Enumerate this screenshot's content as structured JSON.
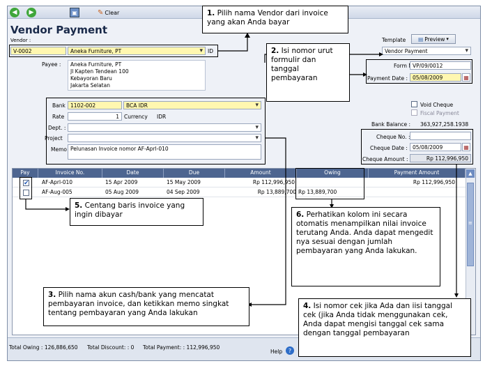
{
  "toolbar": {
    "clear_label": "Clear"
  },
  "header": {
    "title": "Vendor Payment",
    "vendor_label": "Vendor :",
    "template_label": "Template",
    "preview_label": "Preview"
  },
  "vendor": {
    "code": "V-0002",
    "name": "Aneka Furniture, PT",
    "id_suffix": "ID"
  },
  "template": {
    "value": "Vendor Payment"
  },
  "form": {
    "form_no_label": "Form No.",
    "form_no": "VP/09/0012",
    "payment_date_label": "Payment Date :",
    "payment_date": "05/08/2009"
  },
  "payee": {
    "label": "Payee :",
    "lines": [
      "Aneka Furniture, PT",
      "Jl Kapten Tendean 100",
      "Kebayoran Baru",
      "Jakarta Selatan"
    ]
  },
  "bank": {
    "bank_label": "Bank :",
    "bank_code": "1102-002",
    "bank_name": "BCA IDR",
    "rate_label": "Rate",
    "rate": "1",
    "currency_label": "Currency",
    "currency": "IDR",
    "dept_label": "Dept. :",
    "project_label": "Project",
    "memo_label": "Memo",
    "memo": "Pelunasan Invoice nomor AF-Aprl-010"
  },
  "cheque": {
    "void_label": "Void Cheque",
    "fiscal_label": "Fiscal Payment",
    "bank_balance_label": "Bank Balance :",
    "bank_balance": "363,927,258.1938",
    "cheque_no_label": "Cheque No. :",
    "cheque_date_label": "Cheque Date :",
    "cheque_date": "05/08/2009",
    "cheque_amount_label": "Cheque Amount :",
    "cheque_amount": "Rp 112,996,950"
  },
  "grid": {
    "headers": [
      "Pay",
      "Invoice No.",
      "Date",
      "Due",
      "Amount",
      "Owing",
      "Payment Amount"
    ],
    "rows": [
      {
        "invoice": "AF-Aprl-010",
        "date": "15 Apr 2009",
        "due": "15 May 2009",
        "amount": "Rp 112,996,950",
        "owing": "",
        "payment": "Rp 112,996,950"
      },
      {
        "invoice": "AF-Aug-005",
        "date": "05 Aug 2009",
        "due": "04 Sep 2009",
        "amount": "Rp 13,889,700",
        "owing": "Rp 13,889,700",
        "payment": ""
      }
    ]
  },
  "footer": {
    "total_owing": "Total Owing : 126,886,650",
    "total_discount": "Total Discount:  : 0",
    "total_payment": "Total Payment:  : 112,996,950",
    "help": "Help"
  },
  "callouts": {
    "c1": {
      "num": "1.",
      "text": "Pilih nama Vendor dari invoice yang akan Anda bayar"
    },
    "c2": {
      "num": "2.",
      "text": "Isi nomor urut formulir dan tanggal pembayaran"
    },
    "c3": {
      "num": "3.",
      "text": "Pilih nama akun cash/bank yang mencatat pembayaran invoice, dan ketikkan memo singkat tentang pembayaran yang Anda lakukan"
    },
    "c4": {
      "num": "4.",
      "text": "Isi nomor cek jika Ada dan iisi tanggal cek (jika Anda tidak menggunakan cek, Anda dapat mengisi tanggal cek sama dengan tanggal pembayaran"
    },
    "c5": {
      "num": "5.",
      "text": "Centang baris invoice yang ingin dibayar"
    },
    "c6": {
      "num": "6.",
      "text": "Perhatikan kolom ini secara otomatis menampilkan nilai invoice terutang Anda. Anda dapat mengedit nya sesuai dengan jumlah pembayaran yang Anda lakukan."
    }
  }
}
